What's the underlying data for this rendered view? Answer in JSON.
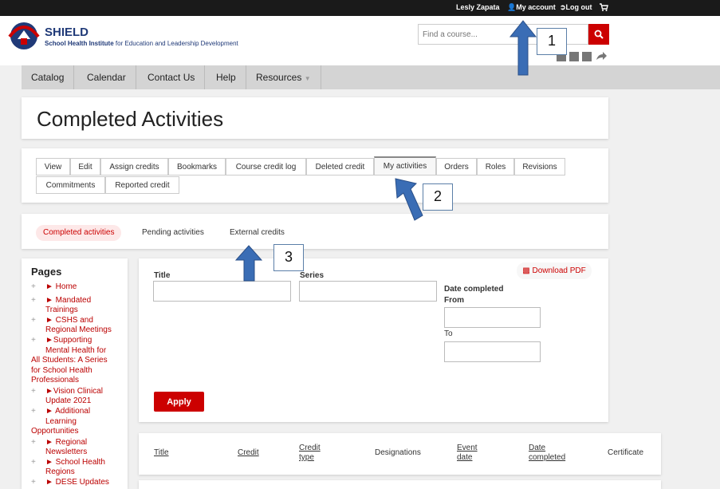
{
  "topbar": {
    "user": "Lesly Zapata",
    "account": "My account",
    "logout": "Log out"
  },
  "header": {
    "brand": "SHIELD",
    "brand_bold": "School Health Institute",
    "brand_rest": " for Education and Leadership Development",
    "search_placeholder": "Find a course..."
  },
  "nav": [
    "Catalog",
    "Calendar",
    "Contact Us",
    "Help",
    "Resources"
  ],
  "page_title": "Completed Activities",
  "tabs_row1": [
    "View",
    "Edit",
    "Assign credits",
    "Bookmarks",
    "Course credit log",
    "Deleted credit",
    "My activities",
    "Orders",
    "Roles",
    "Revisions"
  ],
  "tabs_row2": [
    "Commitments",
    "Reported credit"
  ],
  "subtabs": [
    "Completed activities",
    "Pending activities",
    "External credits"
  ],
  "sidebar": {
    "title": "Pages",
    "items": [
      "► Home",
      "► Mandated",
      "Trainings",
      "► CSHS and",
      "Regional Meetings",
      "►Supporting",
      "Mental Health for",
      "All Students: A Series",
      "for School Health",
      "Professionals",
      "►Vision Clinical",
      "Update 2021",
      "► Additional",
      "Learning",
      "Opportunities",
      "► Regional",
      "Newsletters",
      "► School Health",
      "Regions",
      "► DESE Updates"
    ]
  },
  "filters": {
    "title_label": "Title",
    "series_label": "Series",
    "date_completed_label": "Date completed",
    "from_label": "From",
    "to_label": "To",
    "download_pdf": "Download PDF",
    "apply": "Apply"
  },
  "table_headers": [
    "Title",
    "Credit",
    "Credit type",
    "Designations",
    "Event date",
    "Date completed",
    "Certificate"
  ],
  "callouts": [
    "1",
    "2",
    "3"
  ],
  "colors": {
    "accent": "#cc0000",
    "brand": "#203a78",
    "arrow": "#3a6db5"
  }
}
